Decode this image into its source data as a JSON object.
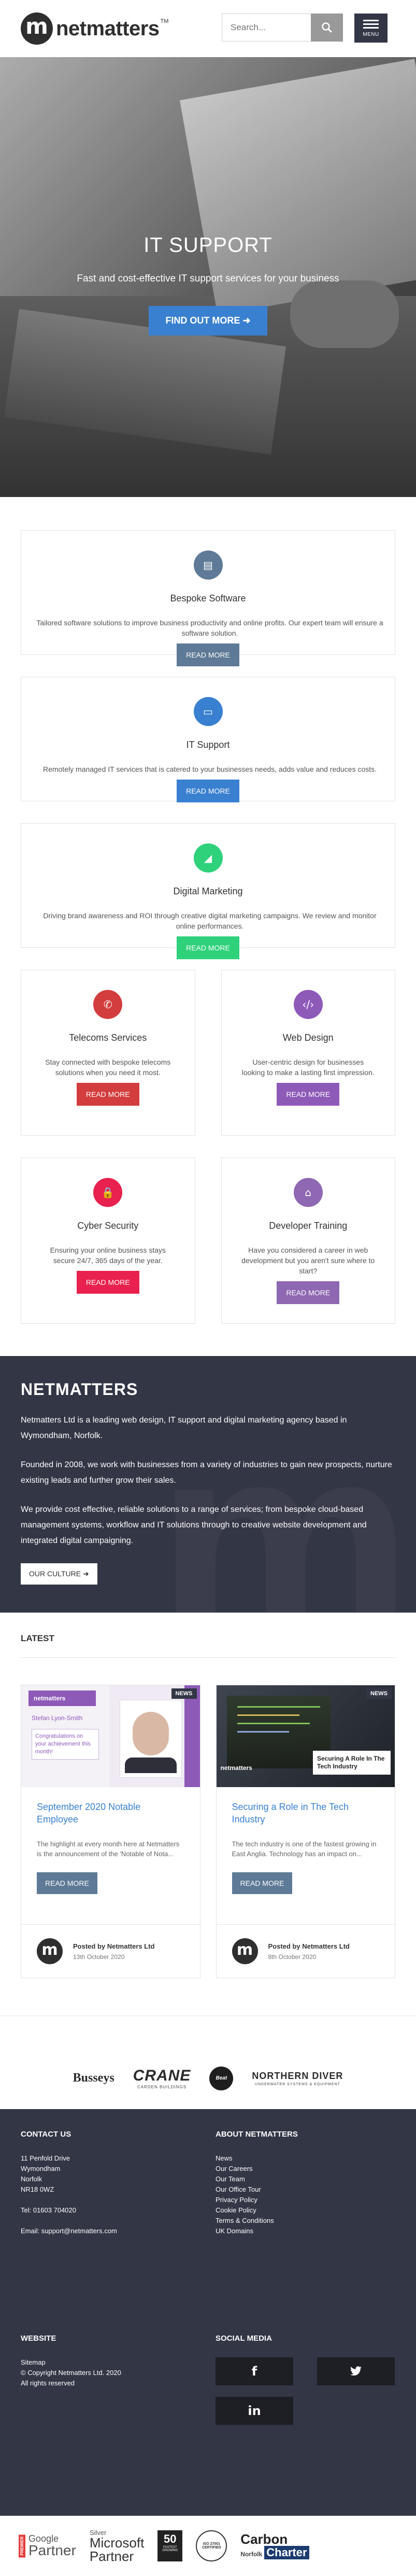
{
  "header": {
    "logo_letter": "m",
    "logo_text": "netmatters",
    "logo_tm": "TM",
    "search_placeholder": "Search...",
    "menu_label": "MENU"
  },
  "hero": {
    "title": "IT SUPPORT",
    "subtitle": "Fast and cost-effective IT support services for your business",
    "button": "FIND OUT MORE",
    "slide_count": 5,
    "active_slide": 1
  },
  "services": [
    {
      "title": "Bespoke Software",
      "desc": "Tailored software solutions to improve business productivity and online profits. Our expert team will ensure a software solution.",
      "button": "READ MORE",
      "color": "#5e7a96",
      "icon": "code-icon",
      "glyph": "▤"
    },
    {
      "title": "IT Support",
      "desc": "Remotely managed IT services that is catered to your businesses needs, adds value and reduces costs.",
      "button": "READ MORE",
      "color": "#3a80d0",
      "icon": "monitor-icon",
      "glyph": "▭"
    },
    {
      "title": "Digital Marketing",
      "desc": "Driving brand awareness and ROI through creative digital marketing campaigns. We review and monitor online performances.",
      "button": "READ MORE",
      "color": "#2fd17b",
      "icon": "chart-icon",
      "glyph": "◢"
    },
    {
      "title": "Telecoms Services",
      "desc": "Stay connected with bespoke telecoms solutions when you need it most.",
      "button": "READ MORE",
      "color": "#d33d3d",
      "icon": "phone-icon",
      "glyph": "✆"
    },
    {
      "title": "Web Design",
      "desc": "User-centric design for businesses looking to make a lasting first impression.",
      "button": "READ MORE",
      "color": "#8e5ab8",
      "icon": "code-brackets-icon",
      "glyph": "‹/›"
    },
    {
      "title": "Cyber Security",
      "desc": "Ensuring your online business stays secure 24/7, 365 days of the year.",
      "button": "READ MORE",
      "color": "#e8214e",
      "icon": "lock-icon",
      "glyph": "🔒"
    },
    {
      "title": "Developer Training",
      "desc": "Have you considered a career in web development but you aren't sure where to start?",
      "button": "READ MORE",
      "color": "#8e68b2",
      "icon": "graduation-cap-icon",
      "glyph": "⌂"
    }
  ],
  "about": {
    "title": "NETMATTERS",
    "p1": "Netmatters Ltd is a leading web design, IT support and digital marketing agency based in Wymondham, Norfolk.",
    "p2": "Founded in 2008, we work with businesses from a variety of industries to gain new prospects, nurture existing leads and further grow their sales.",
    "p3": "We provide cost effective, reliable solutions to a range of services; from bespoke cloud-based management systems, workflow and IT solutions through to creative website development and integrated digital campaigning.",
    "button": "OUR CULTURE",
    "bg_letter": "m"
  },
  "latest": {
    "title": "LATEST",
    "posts": [
      {
        "tag": "NEWS",
        "title": "September 2020 Notable Employee",
        "text": "The highlight at every month here at Netmatters is the announcement of the 'Notable of Nota...",
        "button": "READ MORE",
        "author": "Posted by Netmatters Ltd",
        "date": "13th October 2020",
        "img_header": "netmatters",
        "img_name": "Stefan Lyon-Smith",
        "img_caption": "Congratulations on your achievement this month!"
      },
      {
        "tag": "NEWS",
        "title": "Securing a Role in The Tech Industry",
        "text": "The tech industry is one of the fastest growing in East Anglia. Technology has an impact on...",
        "button": "READ MORE",
        "author": "Posted by Netmatters Ltd",
        "date": "8th October 2020",
        "img_logo": "netmatters",
        "img_title": "Securing A Role In The Tech Industry"
      }
    ]
  },
  "clients": [
    "Busseys",
    "CRANE",
    "Beat",
    "NORTHERN DIVER"
  ],
  "clients_sub": {
    "crane": "CARDEN BUILDINGS",
    "northern": "UNDERWATER SYSTEMS & EQUIPMENT"
  },
  "footer": {
    "contact_title": "CONTACT US",
    "address": [
      "11 Penfold Drive",
      "Wymondham",
      "Norfolk",
      "NR18 0WZ"
    ],
    "tel": "Tel: 01603 704020",
    "email": "Email: support@netmatters.com",
    "about_title": "ABOUT NETMATTERS",
    "about_links": [
      "News",
      "Our Careers",
      "Our Team",
      "Our Office Tour",
      "Privacy Policy",
      "Cookie Policy",
      "Terms & Conditions",
      "UK Domains"
    ],
    "website_title": "WEBSITE",
    "website_lines": [
      "Sitemap",
      "© Copyright Netmatters Ltd. 2020",
      "All rights reserved"
    ],
    "social_title": "SOCIAL MEDIA",
    "social": [
      "f",
      "twitter",
      "in"
    ]
  },
  "partners": {
    "google_main": "Google",
    "google_sub": "Partner",
    "google_premier": "PREMIER",
    "ms_silver": "Silver",
    "ms_main": "Microsoft",
    "ms_sub": "Partner",
    "award_50": "50",
    "award_label": "FASTEST GROWING",
    "iso_label": "ISO 27001 CERTIFIED",
    "carbon_main": "Carbon",
    "carbon_sub": "Charter",
    "carbon_pre": "Norfolk"
  }
}
